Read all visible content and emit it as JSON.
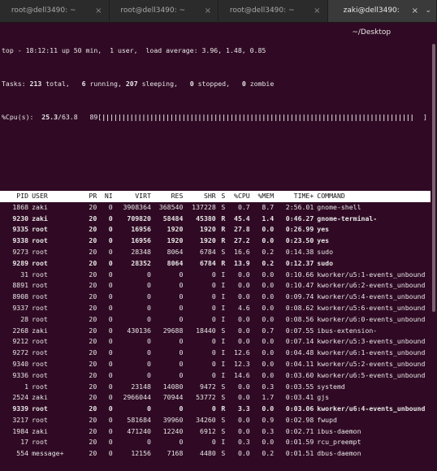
{
  "tabs": [
    {
      "label": "root@dell3490: ~",
      "close": "×"
    },
    {
      "label": "root@dell3490: ~",
      "close": "×"
    },
    {
      "label": "root@dell3490: ~",
      "close": "×"
    },
    {
      "label": "zaki@dell3490: ~/Desktop",
      "close": "×",
      "menu": "⌄"
    }
  ],
  "summary": {
    "line1": "top - 18:12:11 up 50 min,  1 user,  load average: 3.96, 1.48, 0.85",
    "tasks_prefix": "Tasks: ",
    "tasks_total": "213",
    "tasks_total_label": " total,   ",
    "tasks_running": "6",
    "tasks_running_label": " running, ",
    "tasks_sleeping": "207",
    "tasks_sleeping_label": " sleeping,   ",
    "tasks_stopped": "0",
    "tasks_stopped_label": " stopped,   ",
    "tasks_zombie": "0",
    "tasks_zombie_label": " zombie",
    "cpu_prefix": "%Cpu(s):  ",
    "cpu_value": "25.3",
    "cpu_rest": "/63.8   89[",
    "cpu_bars": "||||||||||||||||||||||||||||||||||||||||||||||||||||||||||||||||||||||||||||||",
    "cpu_close": "]"
  },
  "columns": [
    "PID",
    "USER",
    "PR",
    "NI",
    "VIRT",
    "RES",
    "SHR",
    "S",
    "%CPU",
    "%MEM",
    "TIME+",
    "COMMAND"
  ],
  "processes": [
    {
      "pid": "1868",
      "user": "zaki",
      "pr": "20",
      "ni": "0",
      "virt": "3908364",
      "res": "368540",
      "shr": "137228",
      "s": "S",
      "cpu": "0.7",
      "mem": "8.7",
      "time": "2:56.01",
      "cmd": "gnome-shell",
      "bold": false
    },
    {
      "pid": "9230",
      "user": "zaki",
      "pr": "20",
      "ni": "0",
      "virt": "709820",
      "res": "58484",
      "shr": "45380",
      "s": "R",
      "cpu": "45.4",
      "mem": "1.4",
      "time": "0:46.27",
      "cmd": "gnome-terminal-",
      "bold": true
    },
    {
      "pid": "9335",
      "user": "root",
      "pr": "20",
      "ni": "0",
      "virt": "16956",
      "res": "1920",
      "shr": "1920",
      "s": "R",
      "cpu": "27.8",
      "mem": "0.0",
      "time": "0:26.99",
      "cmd": "yes",
      "bold": true
    },
    {
      "pid": "9338",
      "user": "root",
      "pr": "20",
      "ni": "0",
      "virt": "16956",
      "res": "1920",
      "shr": "1920",
      "s": "R",
      "cpu": "27.2",
      "mem": "0.0",
      "time": "0:23.50",
      "cmd": "yes",
      "bold": true
    },
    {
      "pid": "9273",
      "user": "root",
      "pr": "20",
      "ni": "0",
      "virt": "28348",
      "res": "8064",
      "shr": "6784",
      "s": "S",
      "cpu": "16.6",
      "mem": "0.2",
      "time": "0:14.38",
      "cmd": "sudo",
      "bold": false
    },
    {
      "pid": "9289",
      "user": "root",
      "pr": "20",
      "ni": "0",
      "virt": "28352",
      "res": "8064",
      "shr": "6784",
      "s": "R",
      "cpu": "13.9",
      "mem": "0.2",
      "time": "0:12.37",
      "cmd": "sudo",
      "bold": true
    },
    {
      "pid": "31",
      "user": "root",
      "pr": "20",
      "ni": "0",
      "virt": "0",
      "res": "0",
      "shr": "0",
      "s": "I",
      "cpu": "0.0",
      "mem": "0.0",
      "time": "0:10.66",
      "cmd": "kworker/u5:1-events_unbound",
      "bold": false
    },
    {
      "pid": "8891",
      "user": "root",
      "pr": "20",
      "ni": "0",
      "virt": "0",
      "res": "0",
      "shr": "0",
      "s": "I",
      "cpu": "0.0",
      "mem": "0.0",
      "time": "0:10.47",
      "cmd": "kworker/u6:2-events_unbound",
      "bold": false
    },
    {
      "pid": "8908",
      "user": "root",
      "pr": "20",
      "ni": "0",
      "virt": "0",
      "res": "0",
      "shr": "0",
      "s": "I",
      "cpu": "0.0",
      "mem": "0.0",
      "time": "0:09.74",
      "cmd": "kworker/u5:4-events_unbound",
      "bold": false
    },
    {
      "pid": "9337",
      "user": "root",
      "pr": "20",
      "ni": "0",
      "virt": "0",
      "res": "0",
      "shr": "0",
      "s": "I",
      "cpu": "4.6",
      "mem": "0.0",
      "time": "0:08.62",
      "cmd": "kworker/u5:6-events_unbound",
      "bold": false
    },
    {
      "pid": "28",
      "user": "root",
      "pr": "20",
      "ni": "0",
      "virt": "0",
      "res": "0",
      "shr": "0",
      "s": "I",
      "cpu": "0.0",
      "mem": "0.0",
      "time": "0:08.56",
      "cmd": "kworker/u6:0-events_unbound",
      "bold": false
    },
    {
      "pid": "2268",
      "user": "zaki",
      "pr": "20",
      "ni": "0",
      "virt": "430136",
      "res": "29688",
      "shr": "18440",
      "s": "S",
      "cpu": "0.0",
      "mem": "0.7",
      "time": "0:07.55",
      "cmd": "ibus-extension-",
      "bold": false
    },
    {
      "pid": "9212",
      "user": "root",
      "pr": "20",
      "ni": "0",
      "virt": "0",
      "res": "0",
      "shr": "0",
      "s": "I",
      "cpu": "0.0",
      "mem": "0.0",
      "time": "0:07.14",
      "cmd": "kworker/u5:3-events_unbound",
      "bold": false
    },
    {
      "pid": "9272",
      "user": "root",
      "pr": "20",
      "ni": "0",
      "virt": "0",
      "res": "0",
      "shr": "0",
      "s": "I",
      "cpu": "12.6",
      "mem": "0.0",
      "time": "0:04.48",
      "cmd": "kworker/u6:1-events_unbound",
      "bold": false
    },
    {
      "pid": "9340",
      "user": "root",
      "pr": "20",
      "ni": "0",
      "virt": "0",
      "res": "0",
      "shr": "0",
      "s": "I",
      "cpu": "12.3",
      "mem": "0.0",
      "time": "0:04.11",
      "cmd": "kworker/u5:2-events_unbound",
      "bold": false
    },
    {
      "pid": "9336",
      "user": "root",
      "pr": "20",
      "ni": "0",
      "virt": "0",
      "res": "0",
      "shr": "0",
      "s": "I",
      "cpu": "14.6",
      "mem": "0.0",
      "time": "0:03.60",
      "cmd": "kworker/u6:5-events_unbound",
      "bold": false
    },
    {
      "pid": "1",
      "user": "root",
      "pr": "20",
      "ni": "0",
      "virt": "23148",
      "res": "14080",
      "shr": "9472",
      "s": "S",
      "cpu": "0.0",
      "mem": "0.3",
      "time": "0:03.55",
      "cmd": "systemd",
      "bold": false
    },
    {
      "pid": "2524",
      "user": "zaki",
      "pr": "20",
      "ni": "0",
      "virt": "2966044",
      "res": "70944",
      "shr": "53772",
      "s": "S",
      "cpu": "0.0",
      "mem": "1.7",
      "time": "0:03.41",
      "cmd": "gjs",
      "bold": false
    },
    {
      "pid": "9339",
      "user": "root",
      "pr": "20",
      "ni": "0",
      "virt": "0",
      "res": "0",
      "shr": "0",
      "s": "R",
      "cpu": "3.3",
      "mem": "0.0",
      "time": "0:03.06",
      "cmd": "kworker/u6:4-events_unbound",
      "bold": true
    },
    {
      "pid": "3217",
      "user": "root",
      "pr": "20",
      "ni": "0",
      "virt": "581684",
      "res": "39960",
      "shr": "34260",
      "s": "S",
      "cpu": "0.0",
      "mem": "0.9",
      "time": "0:02.98",
      "cmd": "fwupd",
      "bold": false
    },
    {
      "pid": "1984",
      "user": "zaki",
      "pr": "20",
      "ni": "0",
      "virt": "471240",
      "res": "12240",
      "shr": "6912",
      "s": "S",
      "cpu": "0.0",
      "mem": "0.3",
      "time": "0:02.71",
      "cmd": "ibus-daemon",
      "bold": false
    },
    {
      "pid": "17",
      "user": "root",
      "pr": "20",
      "ni": "0",
      "virt": "0",
      "res": "0",
      "shr": "0",
      "s": "I",
      "cpu": "0.3",
      "mem": "0.0",
      "time": "0:01.59",
      "cmd": "rcu_preempt",
      "bold": false
    },
    {
      "pid": "554",
      "user": "message+",
      "pr": "20",
      "ni": "0",
      "virt": "12156",
      "res": "7168",
      "shr": "4480",
      "s": "S",
      "cpu": "0.0",
      "mem": "0.2",
      "time": "0:01.51",
      "cmd": "dbus-daemon",
      "bold": false
    }
  ]
}
